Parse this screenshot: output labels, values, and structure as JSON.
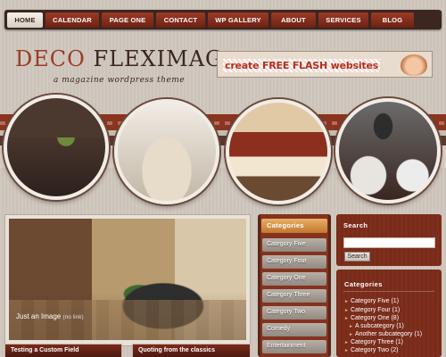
{
  "nav": {
    "items": [
      {
        "label": "HOME"
      },
      {
        "label": "CALENDAR"
      },
      {
        "label": "PAGE ONE"
      },
      {
        "label": "CONTACT"
      },
      {
        "label": "WP GALLERY"
      },
      {
        "label": "ABOUT"
      },
      {
        "label": "SERVICES"
      },
      {
        "label": "BLOG"
      }
    ],
    "active_index": 0
  },
  "header": {
    "logo_part1": "DECO",
    "logo_part2": "FLEXIMAG",
    "tagline": "a magazine wordpress theme",
    "banner_text": "create FREE FLASH websites"
  },
  "feature": {
    "caption": "Just an Image",
    "caption_note": "(no link)"
  },
  "bottom_boxes": [
    {
      "title": "Testing a Custom Field"
    },
    {
      "title": "Quoting from the classics"
    }
  ],
  "categories_column": {
    "title": "Categories",
    "items": [
      "Category Five",
      "Category Four",
      "Category One",
      "Category Three",
      "Category Two",
      "Comedy",
      "Entertainment"
    ]
  },
  "sidebar": {
    "search_title": "Search",
    "search_value": "",
    "search_button": "Search",
    "categories_title": "Categories",
    "categories": [
      {
        "label": "Category Five (1)",
        "level": 0
      },
      {
        "label": "Category Four (1)",
        "level": 0
      },
      {
        "label": "Category One (8)",
        "level": 0
      },
      {
        "label": "A subcategory (1)",
        "level": 1
      },
      {
        "label": "Another subcategory (1)",
        "level": 1
      },
      {
        "label": "Category Three (1)",
        "level": 0
      },
      {
        "label": "Category Two (2)",
        "level": 0
      }
    ]
  },
  "colors": {
    "brand_dark": "#3b2620",
    "accent_red": "#9b3b26",
    "accent_orange": "#e8b066",
    "page_bg": "#cfc7bd"
  }
}
